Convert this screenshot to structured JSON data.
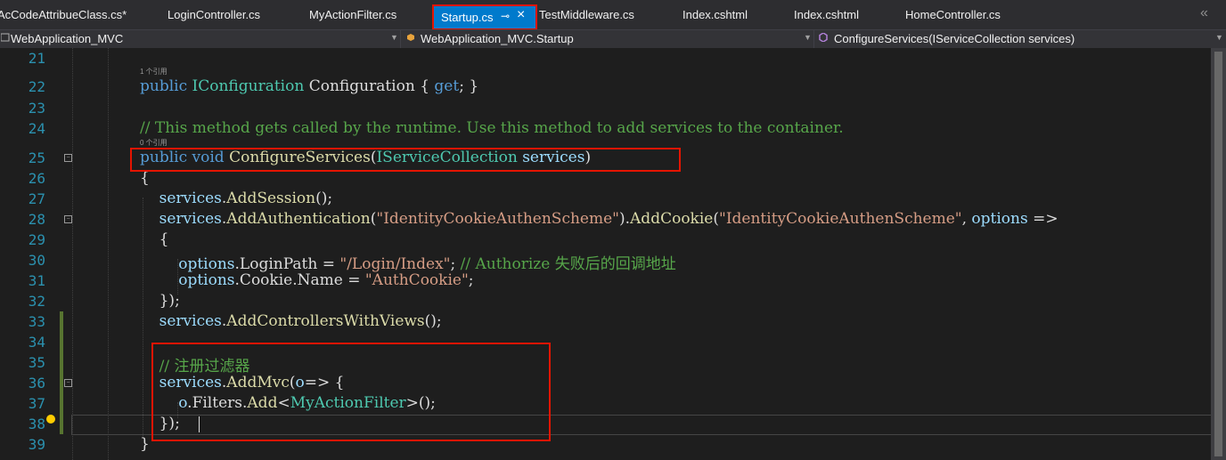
{
  "tabs": [
    {
      "label": "AcCodeAttribueClass.cs*",
      "active": false
    },
    {
      "label": "LoginController.cs",
      "active": false
    },
    {
      "label": "MyActionFilter.cs",
      "active": false
    },
    {
      "label": "Startup.cs",
      "active": true
    },
    {
      "label": "TestMiddleware.cs",
      "active": false
    },
    {
      "label": "Index.cshtml",
      "active": false
    },
    {
      "label": "Index.cshtml",
      "active": false
    },
    {
      "label": "HomeController.cs",
      "active": false
    }
  ],
  "tab_icons": {
    "pin": "pin-icon",
    "close": "close-icon",
    "overflow": "chevron-double-left-icon"
  },
  "navbar": {
    "project": "WebApplication_MVC",
    "type": "WebApplication_MVC.Startup",
    "member": "ConfigureServices(IServiceCollection services)"
  },
  "codelens": {
    "line22": "1 个引用",
    "line25": "0 个引用"
  },
  "colors": {
    "accent": "#007acc",
    "highlight_box": "#e51400",
    "keyword": "#569cd6",
    "type": "#4ec9b0",
    "method": "#dcdcaa",
    "string": "#d69d85",
    "comment": "#57a64a",
    "line_number": "#2b91af"
  },
  "lines": [
    {
      "n": "21",
      "tokens": []
    },
    {
      "n": "22",
      "tokens": [
        [
          "kw",
          "public"
        ],
        [
          "p",
          " "
        ],
        [
          "ty",
          "IConfiguration"
        ],
        [
          "p",
          " Configuration { "
        ],
        [
          "kw",
          "get"
        ],
        [
          "p",
          "; }"
        ]
      ]
    },
    {
      "n": "23",
      "tokens": []
    },
    {
      "n": "24",
      "tokens": [
        [
          "cm",
          "// This method gets called by the runtime. Use this method to add services to the container."
        ]
      ]
    },
    {
      "n": "25",
      "tokens": [
        [
          "kw",
          "public"
        ],
        [
          "p",
          " "
        ],
        [
          "kw",
          "void"
        ],
        [
          "p",
          " "
        ],
        [
          "mt",
          "ConfigureServices"
        ],
        [
          "p",
          "("
        ],
        [
          "ty",
          "IServiceCollection"
        ],
        [
          "p",
          " "
        ],
        [
          "pm",
          "services"
        ],
        [
          "p",
          ")"
        ]
      ]
    },
    {
      "n": "26",
      "tokens": [
        [
          "p",
          "{"
        ]
      ]
    },
    {
      "n": "27",
      "tokens": [
        [
          "p",
          "    "
        ],
        [
          "pm",
          "services"
        ],
        [
          "p",
          "."
        ],
        [
          "mt",
          "AddSession"
        ],
        [
          "p",
          "();"
        ]
      ]
    },
    {
      "n": "28",
      "tokens": [
        [
          "p",
          "    "
        ],
        [
          "pm",
          "services"
        ],
        [
          "p",
          "."
        ],
        [
          "mt",
          "AddAuthentication"
        ],
        [
          "p",
          "("
        ],
        [
          "st",
          "\"IdentityCookieAuthenScheme\""
        ],
        [
          "p",
          ")."
        ],
        [
          "mt",
          "AddCookie"
        ],
        [
          "p",
          "("
        ],
        [
          "st",
          "\"IdentityCookieAuthenScheme\""
        ],
        [
          "p",
          ", "
        ],
        [
          "pm",
          "options"
        ],
        [
          "p",
          " =>"
        ]
      ]
    },
    {
      "n": "29",
      "tokens": [
        [
          "p",
          "    {"
        ]
      ]
    },
    {
      "n": "30",
      "tokens": [
        [
          "p",
          "        "
        ],
        [
          "pm",
          "options"
        ],
        [
          "p",
          ".LoginPath = "
        ],
        [
          "st",
          "\"/Login/Index\""
        ],
        [
          "p",
          "; "
        ],
        [
          "cm",
          "// Authorize 失败后的回调地址"
        ]
      ]
    },
    {
      "n": "31",
      "tokens": [
        [
          "p",
          "        "
        ],
        [
          "pm",
          "options"
        ],
        [
          "p",
          ".Cookie.Name = "
        ],
        [
          "st",
          "\"AuthCookie\""
        ],
        [
          "p",
          ";"
        ]
      ]
    },
    {
      "n": "32",
      "tokens": [
        [
          "p",
          "    });"
        ]
      ]
    },
    {
      "n": "33",
      "tokens": [
        [
          "p",
          "    "
        ],
        [
          "pm",
          "services"
        ],
        [
          "p",
          "."
        ],
        [
          "mt",
          "AddControllersWithViews"
        ],
        [
          "p",
          "();"
        ]
      ]
    },
    {
      "n": "34",
      "tokens": []
    },
    {
      "n": "35",
      "tokens": [
        [
          "p",
          "    "
        ],
        [
          "cm",
          "// 注册过滤器"
        ]
      ]
    },
    {
      "n": "36",
      "tokens": [
        [
          "p",
          "    "
        ],
        [
          "pm",
          "services"
        ],
        [
          "p",
          "."
        ],
        [
          "mt",
          "AddMvc"
        ],
        [
          "p",
          "("
        ],
        [
          "pm",
          "o"
        ],
        [
          "p",
          "=> {"
        ]
      ]
    },
    {
      "n": "37",
      "tokens": [
        [
          "p",
          "        "
        ],
        [
          "pm",
          "o"
        ],
        [
          "p",
          ".Filters."
        ],
        [
          "mt",
          "Add"
        ],
        [
          "p",
          "<"
        ],
        [
          "ty",
          "MyActionFilter"
        ],
        [
          "p",
          ">();"
        ]
      ]
    },
    {
      "n": "38",
      "tokens": [
        [
          "p",
          "    });"
        ]
      ]
    },
    {
      "n": "39",
      "tokens": [
        [
          "p",
          "}"
        ]
      ]
    }
  ]
}
